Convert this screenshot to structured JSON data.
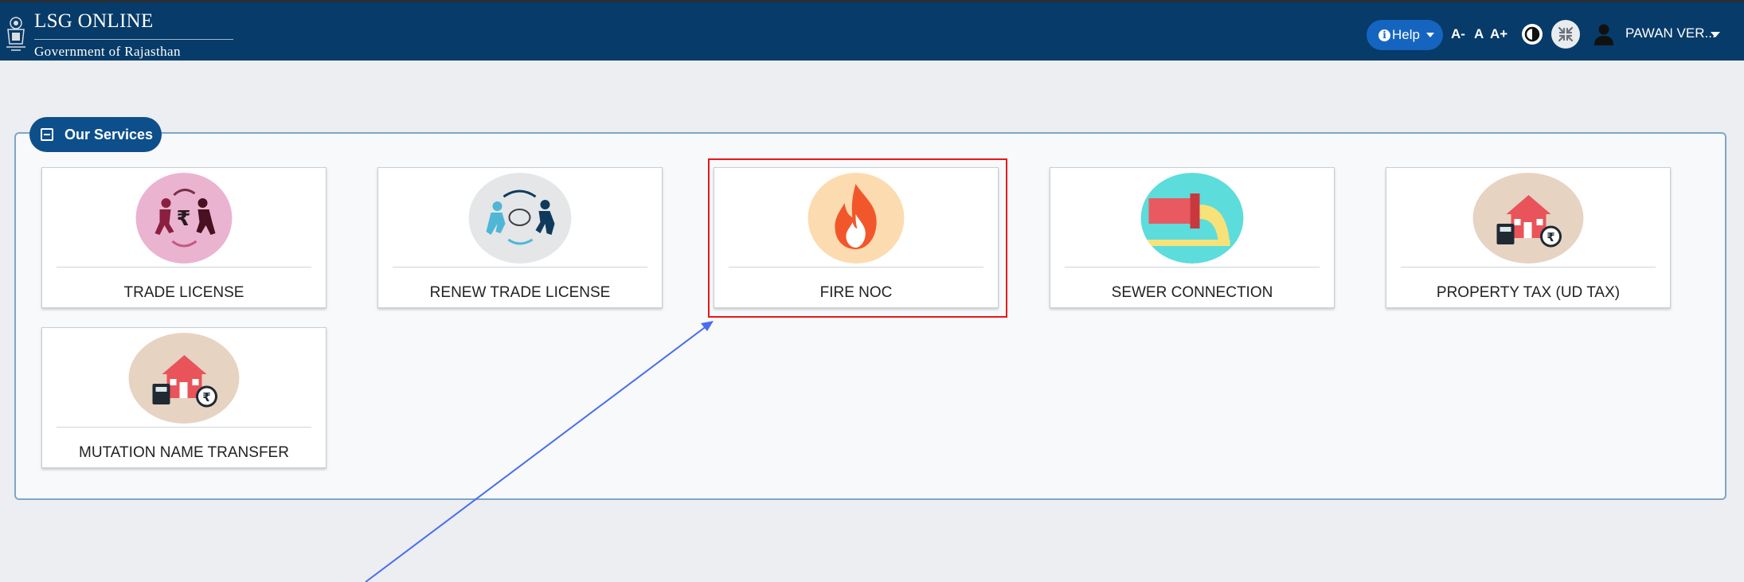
{
  "header": {
    "brand_title": "LSG ONLINE",
    "brand_subtitle": "Government of Rajasthan",
    "help_label": "Help",
    "font_decrease": "A-",
    "font_normal": "A",
    "font_increase": "A+",
    "user_name": "PAWAN VER...",
    "colors": {
      "bar": "#073b69",
      "help": "#1565c0"
    }
  },
  "services": {
    "title": "Our Services",
    "items": [
      {
        "label": "TRADE LICENSE",
        "icon": "trade-license-icon"
      },
      {
        "label": "RENEW TRADE LICENSE",
        "icon": "renew-trade-license-icon"
      },
      {
        "label": "FIRE NOC",
        "icon": "fire-icon"
      },
      {
        "label": "SEWER CONNECTION",
        "icon": "sewer-pipe-icon"
      },
      {
        "label": "PROPERTY TAX (UD TAX)",
        "icon": "property-tax-icon"
      },
      {
        "label": "MUTATION NAME TRANSFER",
        "icon": "mutation-house-icon"
      }
    ]
  },
  "annotation": {
    "highlight_color": "#e8181c",
    "arrow_color": "#4a6cf0"
  }
}
